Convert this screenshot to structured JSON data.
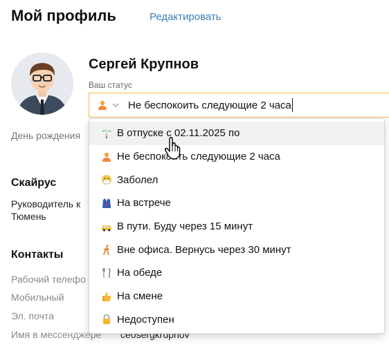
{
  "header": {
    "title": "Мой профиль",
    "edit_label": "Редактировать"
  },
  "profile": {
    "name": "Сергей Крупнов",
    "status_label": "Ваш статус",
    "status_value": "Не беспокоить следующие 2 часа",
    "status_icon": "dnd-person-icon",
    "birthday_label": "День рождения"
  },
  "company": {
    "title": "Скайрус",
    "position": "Руководитель к",
    "city": "Тюмень"
  },
  "contacts": {
    "title": "Контакты",
    "work_phone_label": "Рабочий телефо",
    "mobile_label": "Мобильный",
    "email_label": "Эл. почта",
    "messenger_label": "Имя в мессенджере",
    "messenger_value": "ceosergkrupnov"
  },
  "status_options": [
    {
      "label": "В отпуске с 02.11.2025 по",
      "icon": "palm-tree-icon"
    },
    {
      "label": "Не беспокоить следующие 2 часа",
      "icon": "dnd-person-icon"
    },
    {
      "label": "Заболел",
      "icon": "sick-face-icon"
    },
    {
      "label": "На встрече",
      "icon": "suit-icon"
    },
    {
      "label": "В пути. Буду через 15 минут",
      "icon": "taxi-icon"
    },
    {
      "label": "Вне офиса. Вернусь через 30 минут",
      "icon": "walking-person-icon"
    },
    {
      "label": "На обеде",
      "icon": "fork-knife-icon"
    },
    {
      "label": "На смене",
      "icon": "thumbs-up-icon"
    },
    {
      "label": "Недоступен",
      "icon": "lock-icon"
    }
  ],
  "colors": {
    "accent_border": "#f0b94b",
    "link": "#3d7fb0",
    "hover_row": "#f1f1f1"
  }
}
